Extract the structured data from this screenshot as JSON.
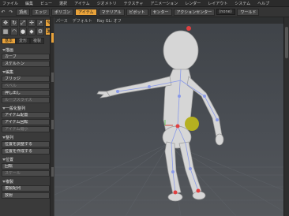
{
  "menubar": {
    "items": [
      "ファイル",
      "編集",
      "ビュー",
      "選択",
      "アイテム",
      "ジオメトリ",
      "テクスチャ",
      "アニメーション",
      "レンダー",
      "レイアウト",
      "システム",
      "ヘルプ"
    ]
  },
  "toolbar": {
    "tabs": [
      "頂点",
      "エッジ",
      "ポリゴン",
      "アイテム",
      "マテリアル",
      "ピボット",
      "センター"
    ],
    "active_tab": "アイテム",
    "action_label": "アクションセンター",
    "drop_label": "ドロップアクション",
    "field_value": "(none)",
    "symmetry_label": "ワールド",
    "workplane_label": "ワークプレーン"
  },
  "panel": {
    "tabs": [
      "基本",
      "変形",
      "複製"
    ],
    "sections": [
      {
        "title": "描画",
        "buttons": [
          "カーブ",
          "スケルトン"
        ]
      },
      {
        "title": "編集",
        "buttons": [
          "ブリッジ",
          "ベベル",
          "押し出し",
          "ループスライス"
        ]
      },
      {
        "title": "一般化整列",
        "buttons": [
          "アイテム配置",
          "アイテム回転",
          "アイテム縮小"
        ]
      },
      {
        "title": "整列",
        "buttons": [
          "位置を調整する",
          "位置を作成する"
        ]
      },
      {
        "title": "位置",
        "buttons": [
          "回転",
          "スケール"
        ]
      },
      {
        "title": "他",
        "buttons": [
          "中心",
          "方向"
        ]
      },
      {
        "title": "複製",
        "buttons": [
          "複製配列",
          "放射"
        ]
      }
    ]
  },
  "viewport": {
    "header_items": [
      "パース",
      "デフォルト",
      "Ray GL: オフ"
    ]
  },
  "colors": {
    "accent": "#e8a23a",
    "model_body": "#d6d6d6",
    "joint_red": "#e04040",
    "joint_blue": "#8a9ae8",
    "light_yellow": "#b5b020",
    "grid": "#5c6066"
  },
  "icons": [
    "move-icon",
    "rotate-icon",
    "scale-icon",
    "transform-icon",
    "select-icon",
    "brush-icon",
    "mesh-icon",
    "bend-icon",
    "pin-icon",
    "drop-icon",
    "settings-icon",
    "snap-icon"
  ]
}
